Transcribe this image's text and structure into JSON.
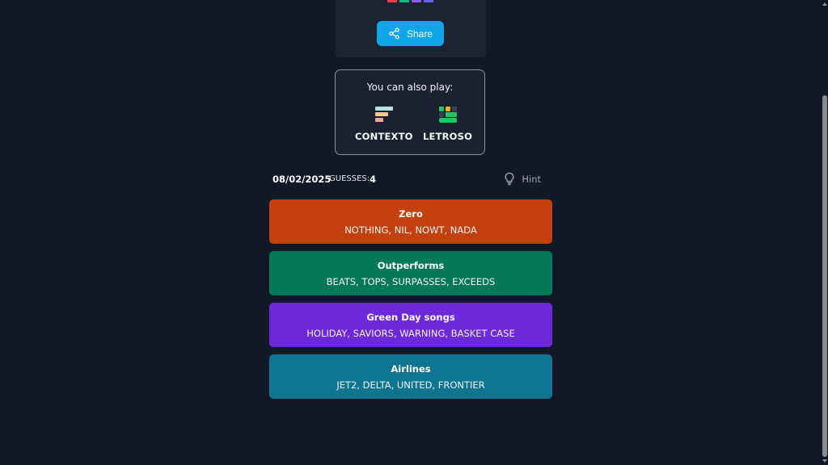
{
  "share": {
    "label": "Share",
    "squares": [
      "#ef4444",
      "#10b981",
      "#8b5cf6",
      "#6366f1"
    ]
  },
  "also_play": {
    "title": "You can also play:",
    "games": [
      {
        "label": "CONTEXTO",
        "icon": "contexto-logo-icon"
      },
      {
        "label": "LETROSO",
        "icon": "letroso-logo-icon"
      }
    ]
  },
  "status": {
    "date": "08/02/2025",
    "guesses_label": "GUESSES:",
    "guesses_count": "4",
    "hint_label": "Hint"
  },
  "groups": [
    {
      "title": "Zero",
      "words": "NOTHING, NIL, NOWT, NADA",
      "color": "#c2410c"
    },
    {
      "title": "Outperforms",
      "words": "BEATS, TOPS, SURPASSES, EXCEEDS",
      "color": "#047857"
    },
    {
      "title": "Green Day songs",
      "words": "HOLIDAY, SAVIORS, WARNING, BASKET CASE",
      "color": "#6d28d9"
    },
    {
      "title": "Airlines",
      "words": "JET2, DELTA, UNITED, FRONTIER",
      "color": "#0e7490"
    }
  ]
}
